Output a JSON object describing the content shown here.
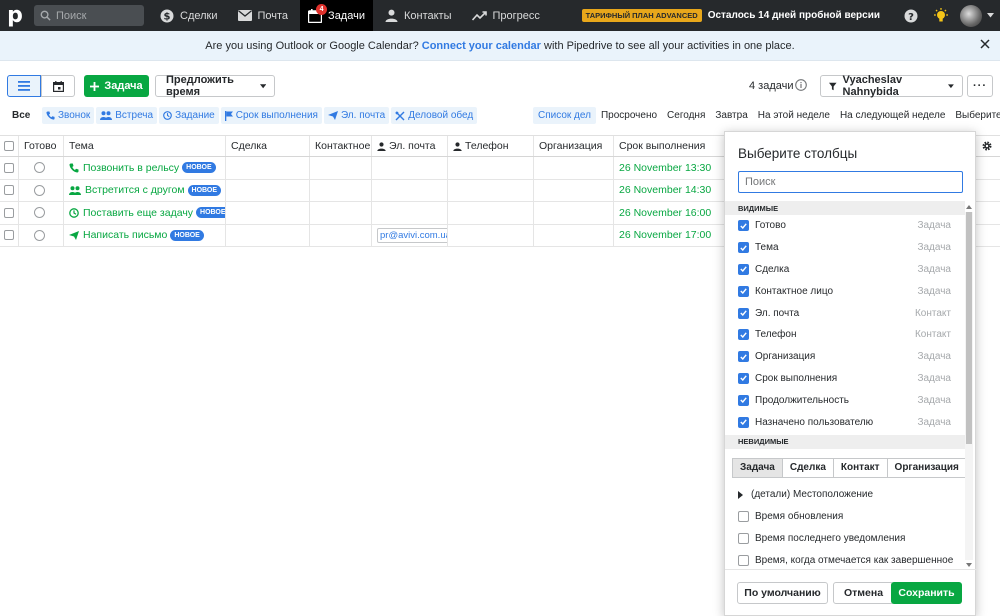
{
  "nav": {
    "logo": "p",
    "search_placeholder": "Поиск",
    "items": [
      {
        "label": "Сделки",
        "icon": "dollar-icon"
      },
      {
        "label": "Почта",
        "icon": "mail-icon"
      },
      {
        "label": "Задачи",
        "icon": "calendar-icon",
        "badge": "4",
        "active": true
      },
      {
        "label": "Контакты",
        "icon": "person-icon"
      },
      {
        "label": "Прогресс",
        "icon": "trend-icon"
      }
    ],
    "plan_badge": "ТАРИФНЫЙ ПЛАН ADVANCED",
    "trial_text": "Осталось 14 дней пробной версии"
  },
  "banner": {
    "text_before": "Are you using Outlook or Google Calendar?",
    "link": "Connect your calendar",
    "text_after": "with Pipedrive to see all your activities in one place."
  },
  "toolbar": {
    "add_label": "Задача",
    "suggest_label": "Предложить время",
    "task_count": "4 задачи",
    "user_filter": "Vyacheslav Nahnybida",
    "more": "···"
  },
  "filters": {
    "all": "Все",
    "types": [
      "Звонок",
      "Встреча",
      "Задание",
      "Срок выполнения",
      "Эл. почта",
      "Деловой обед"
    ],
    "periods": [
      "Список дел",
      "Просрочено",
      "Сегодня",
      "Завтра",
      "На этой неделе",
      "На следующей неделе",
      "Выберите период"
    ]
  },
  "table": {
    "headers": {
      "done": "Готово",
      "subject": "Тема",
      "deal": "Сделка",
      "contact": "Контактное лицо",
      "email": "Эл. почта",
      "phone": "Телефон",
      "org": "Организация",
      "due": "Срок выполнения"
    },
    "rows": [
      {
        "subject": "Позвонить в рельсу",
        "badge": "НОВОЕ",
        "due": "26 November 13:30",
        "email": ""
      },
      {
        "subject": "Встретится с другом",
        "badge": "НОВОЕ",
        "due": "26 November 14:30",
        "email": ""
      },
      {
        "subject": "Поставить еще задачу",
        "badge": "НОВОЕ",
        "due": "26 November 16:00",
        "email": ""
      },
      {
        "subject": "Написать письмо",
        "badge": "НОВОЕ",
        "due": "26 November 17:00",
        "email": "pr@avivi.com.ua"
      }
    ]
  },
  "popup": {
    "title": "Выберите столбцы",
    "search_placeholder": "Поиск",
    "visible_head": "ВИДИМЫЕ",
    "visible": [
      {
        "label": "Готово",
        "source": "Задача"
      },
      {
        "label": "Тема",
        "source": "Задача"
      },
      {
        "label": "Сделка",
        "source": "Задача"
      },
      {
        "label": "Контактное лицо",
        "source": "Задача"
      },
      {
        "label": "Эл. почта",
        "source": "Контакт"
      },
      {
        "label": "Телефон",
        "source": "Контакт"
      },
      {
        "label": "Организация",
        "source": "Задача"
      },
      {
        "label": "Срок выполнения",
        "source": "Задача"
      },
      {
        "label": "Продолжительность",
        "source": "Задача"
      },
      {
        "label": "Назначено пользователю",
        "source": "Задача"
      }
    ],
    "hidden_head": "НЕВИДИМЫЕ",
    "tabs": [
      "Задача",
      "Сделка",
      "Контакт",
      "Организация"
    ],
    "hidden_items": [
      {
        "label": "(детали) Местоположение",
        "type": "tree"
      },
      {
        "label": "Время обновления",
        "type": "check"
      },
      {
        "label": "Время последнего уведомления",
        "type": "check"
      },
      {
        "label": "Время, когда отмечается как завершенное",
        "type": "check"
      }
    ],
    "btn_default": "По умолчанию",
    "btn_cancel": "Отмена",
    "btn_save": "Сохранить"
  },
  "colors": {
    "nav_bg": "#26292c",
    "accent_blue": "#317ae2",
    "accent_green": "#08a742",
    "plan_badge": "#e8a71b",
    "badge_red": "#e0312c"
  }
}
